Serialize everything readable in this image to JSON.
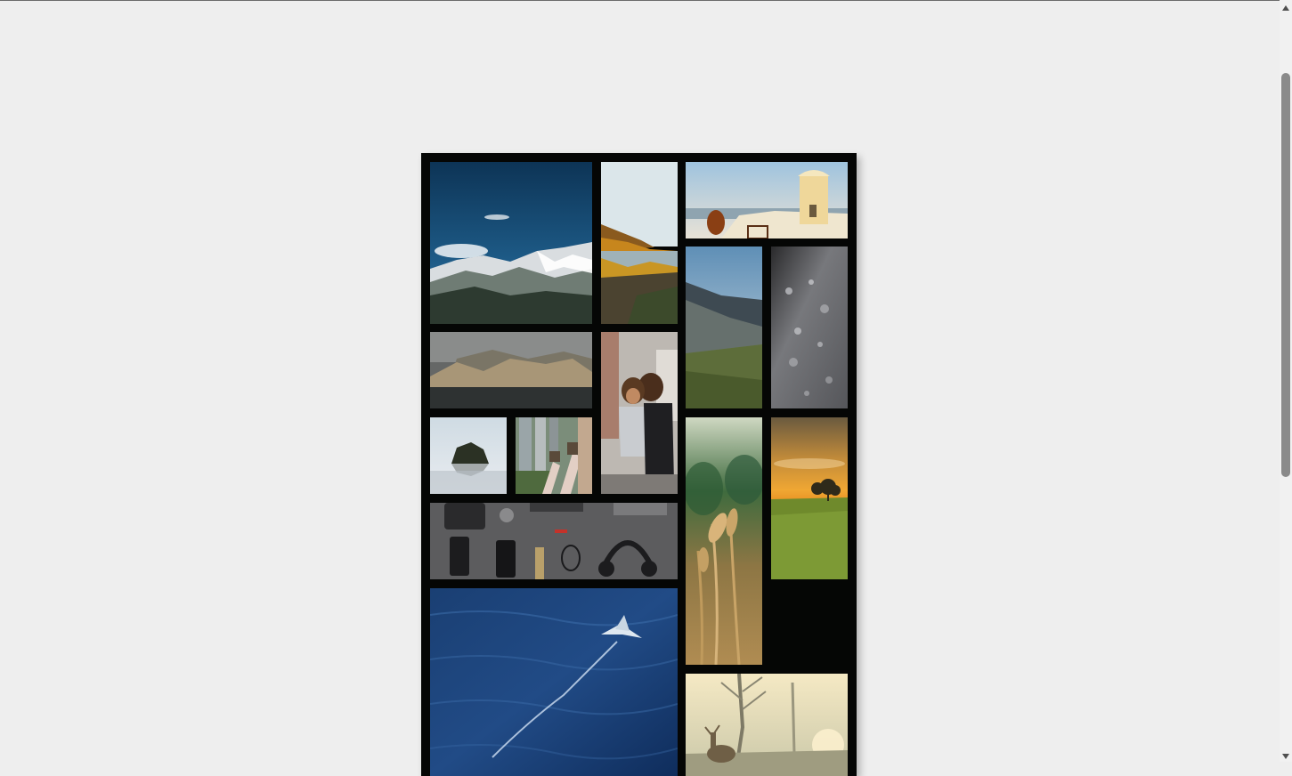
{
  "page": {
    "background": "#eeeeee"
  },
  "gallery": {
    "background": "#050605",
    "photos": [
      "mountain-snow-peak",
      "autumn-lake-reflection",
      "white-windmill-coast",
      "misty-mountain-valley",
      "water-droplets-closeup",
      "rocky-island-coast",
      "mother-and-child",
      "lone-rock-island",
      "skyscraper-feet-view",
      "wheat-stalks",
      "sunset-field-trees",
      "flat-lay-accessories",
      "ocean-bird-flying",
      "deer-misty-forest"
    ]
  },
  "scrollbar": {
    "position": 0.1
  }
}
